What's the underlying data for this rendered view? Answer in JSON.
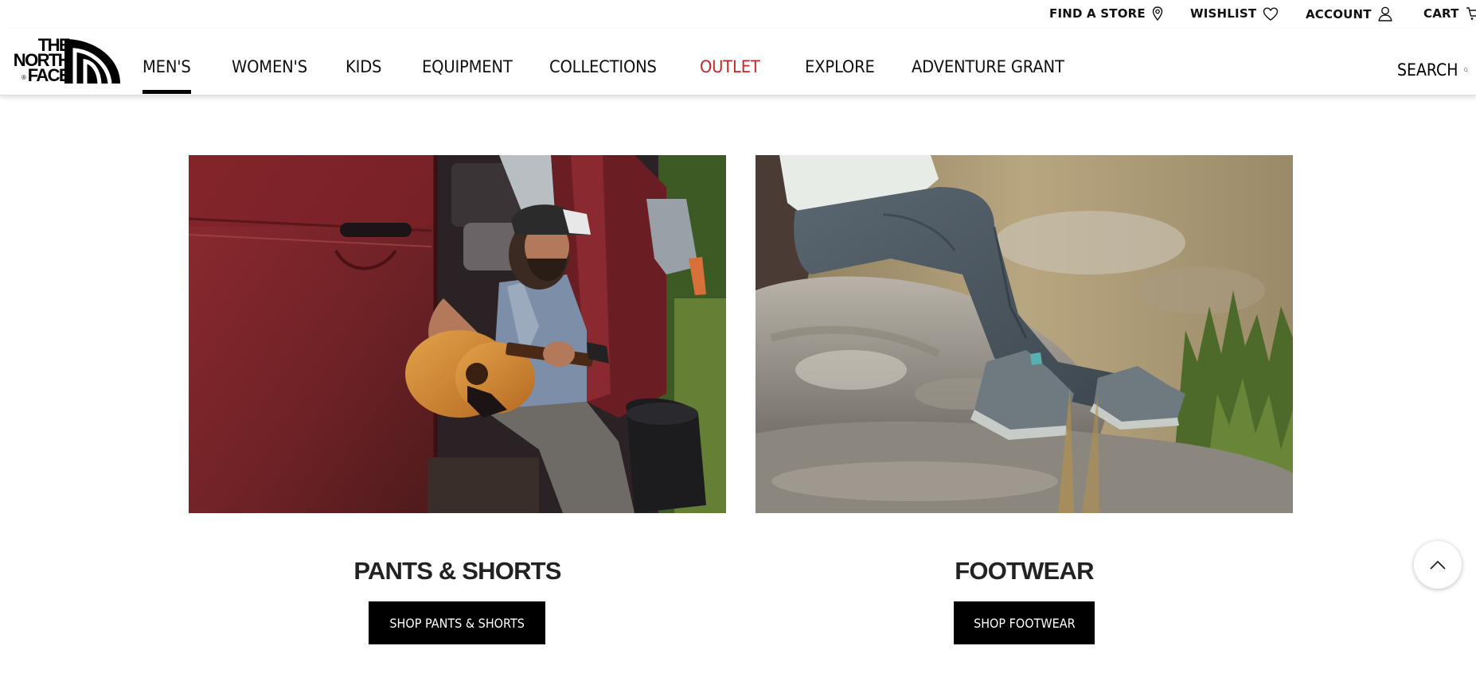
{
  "utility": {
    "find_store": "FIND A STORE",
    "wishlist": "WISHLIST",
    "account": "ACCOUNT",
    "cart": "CART"
  },
  "logo": {
    "lines": [
      "THE",
      "NORTH",
      "FACE"
    ],
    "reg": "®"
  },
  "nav": {
    "items": [
      "MEN'S",
      "WOMEN'S",
      "KIDS",
      "EQUIPMENT",
      "COLLECTIONS",
      "OUTLET",
      "EXPLORE",
      "ADVENTURE GRANT"
    ],
    "active": "MEN'S",
    "outlet_color": "#c62828"
  },
  "search": {
    "label": "SEARCH"
  },
  "cards": [
    {
      "title": "PANTS & SHORTS",
      "button": "SHOP PANTS & SHORTS",
      "image": "man-playing-guitar-in-van-photo"
    },
    {
      "title": "FOOTWEAR",
      "button": "SHOP FOOTWEAR",
      "image": "hiker-sitting-on-rock-photo"
    }
  ],
  "icons": {
    "store": "map-pin-icon",
    "wishlist": "heart-icon",
    "account": "user-icon",
    "cart": "cart-icon",
    "search": "search-icon",
    "back_to_top": "chevron-up-icon"
  },
  "colors": {
    "accent": "#c62828",
    "button_bg": "#000000",
    "text": "#111111"
  }
}
